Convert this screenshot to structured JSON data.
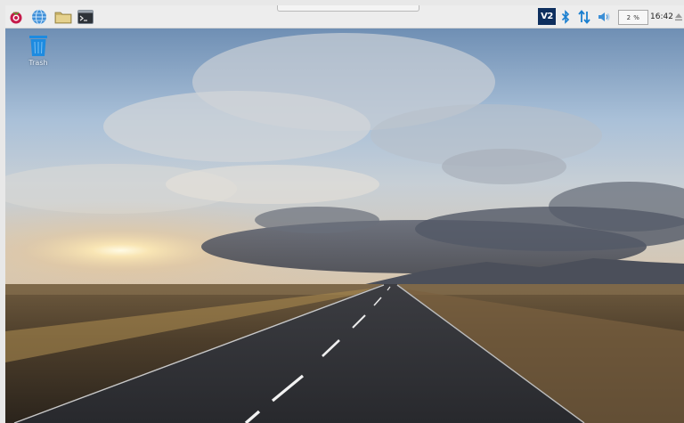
{
  "taskbar": {
    "launchers": [
      {
        "icon": "raspberry-menu-icon"
      },
      {
        "icon": "web-browser-globe-icon"
      },
      {
        "icon": "file-manager-folder-icon"
      },
      {
        "icon": "terminal-icon"
      }
    ],
    "tray": {
      "vnc_label": "V2",
      "bluetooth_icon": "bluetooth-icon",
      "network_icon": "network-arrows-icon",
      "volume_icon": "volume-icon",
      "cpu_usage": "2 %",
      "clock": "16:42",
      "eject_icon": "eject-icon"
    }
  },
  "desktop": {
    "icons": [
      {
        "label": "Trash",
        "icon": "trash-icon"
      }
    ],
    "wallpaper": "road-sunset"
  },
  "colors": {
    "taskbar_bg": "#ededed",
    "vnc_bg": "#0e2f5e",
    "accent_blue": "#1a7fd0",
    "trash_blue": "#1d8be0"
  }
}
